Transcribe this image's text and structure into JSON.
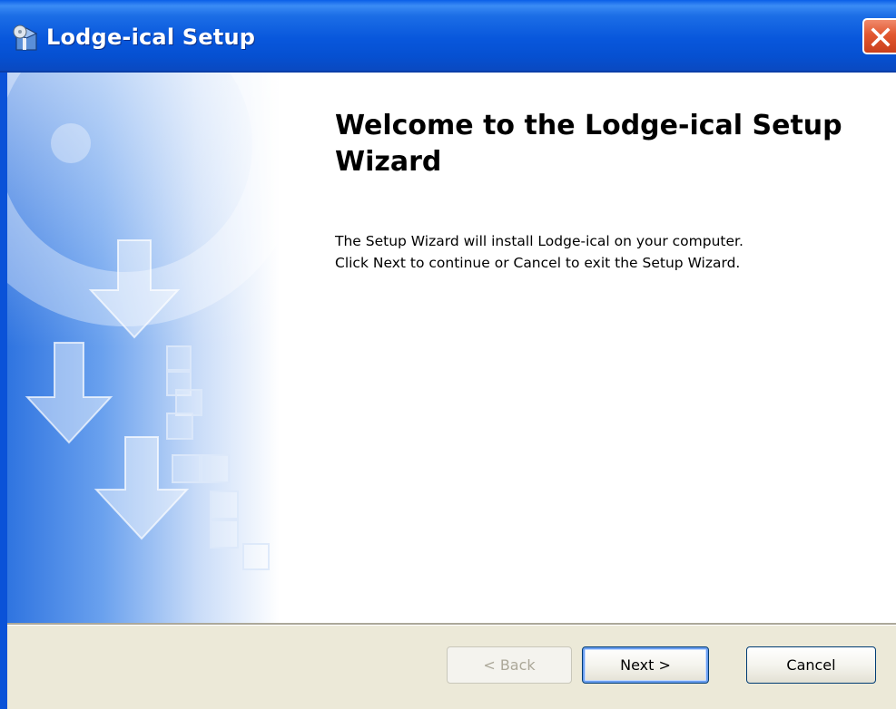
{
  "window": {
    "title": "Lodge-ical Setup",
    "icon": "installer-icon",
    "close_icon": "close-icon"
  },
  "welcome": {
    "title": "Welcome to the Lodge-ical Setup Wizard",
    "body_line1": "The Setup Wizard will install Lodge-ical on your computer.",
    "body_line2": "Click Next to continue or Cancel to exit the Setup Wizard."
  },
  "buttons": {
    "back": "< Back",
    "next": "Next >",
    "cancel": "Cancel"
  },
  "colors": {
    "titlebar": "#0857dc",
    "close": "#e2572f",
    "footer": "#ece9d8",
    "banner_blue": "#3a7ee6"
  }
}
